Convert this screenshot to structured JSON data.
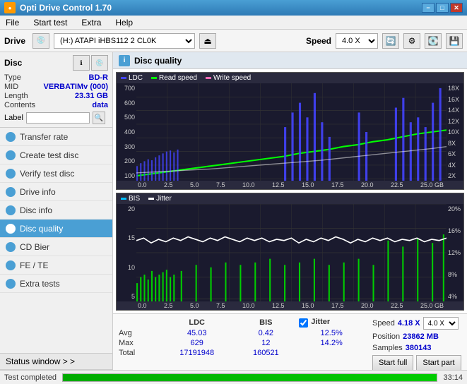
{
  "titlebar": {
    "title": "Opti Drive Control 1.70",
    "minimize": "−",
    "maximize": "□",
    "close": "✕"
  },
  "menubar": {
    "items": [
      "File",
      "Start test",
      "Extra",
      "Help"
    ]
  },
  "toolbar": {
    "drive_label": "Drive",
    "drive_value": "(H:) ATAPI iHBS112  2 CL0K",
    "speed_label": "Speed",
    "speed_value": "4.0 X"
  },
  "sidebar": {
    "disc_header": "Disc",
    "disc_info": [
      {
        "key": "Type",
        "value": "BD-R"
      },
      {
        "key": "MID",
        "value": "VERBATIMv (000)"
      },
      {
        "key": "Length",
        "value": "23.31 GB"
      },
      {
        "key": "Contents",
        "value": "data"
      }
    ],
    "label_placeholder": "",
    "nav_items": [
      {
        "id": "transfer-rate",
        "label": "Transfer rate",
        "active": false
      },
      {
        "id": "create-test-disc",
        "label": "Create test disc",
        "active": false
      },
      {
        "id": "verify-test-disc",
        "label": "Verify test disc",
        "active": false
      },
      {
        "id": "drive-info",
        "label": "Drive info",
        "active": false
      },
      {
        "id": "disc-info",
        "label": "Disc info",
        "active": false
      },
      {
        "id": "disc-quality",
        "label": "Disc quality",
        "active": true
      },
      {
        "id": "cd-bier",
        "label": "CD Bier",
        "active": false
      },
      {
        "id": "fe-te",
        "label": "FE / TE",
        "active": false
      },
      {
        "id": "extra-tests",
        "label": "Extra tests",
        "active": false
      }
    ],
    "status_window": "Status window > >"
  },
  "disc_quality": {
    "title": "Disc quality",
    "icon": "i",
    "legend_top": [
      "LDC",
      "Read speed",
      "Write speed"
    ],
    "legend_bottom": [
      "BIS",
      "Jitter"
    ],
    "chart_top": {
      "y_left": [
        "700",
        "600",
        "500",
        "400",
        "300",
        "200",
        "100"
      ],
      "y_right": [
        "18X",
        "16X",
        "14X",
        "12X",
        "10X",
        "8X",
        "6X",
        "4X",
        "2X"
      ],
      "x_axis": [
        "0.0",
        "2.5",
        "5.0",
        "7.5",
        "10.0",
        "12.5",
        "15.0",
        "17.5",
        "20.0",
        "22.5",
        "25.0 GB"
      ]
    },
    "chart_bottom": {
      "y_left": [
        "20",
        "15",
        "10",
        "5"
      ],
      "y_right": [
        "20%",
        "16%",
        "12%",
        "8%",
        "4%"
      ],
      "x_axis": [
        "0.0",
        "2.5",
        "5.0",
        "7.5",
        "10.0",
        "12.5",
        "15.0",
        "17.5",
        "20.0",
        "22.5",
        "25.0 GB"
      ]
    },
    "stats": {
      "headers": [
        "LDC",
        "BIS",
        "Jitter"
      ],
      "jitter_checked": true,
      "rows": [
        {
          "label": "Avg",
          "ldc": "45.03",
          "bis": "0.42",
          "jitter": "12.5%"
        },
        {
          "label": "Max",
          "ldc": "629",
          "bis": "12",
          "jitter": "14.2%"
        },
        {
          "label": "Total",
          "ldc": "17191948",
          "bis": "160521",
          "jitter": ""
        }
      ],
      "speed_label": "Speed",
      "speed_val": "4.18 X",
      "speed_select": "4.0 X",
      "position_label": "Position",
      "position_val": "23862 MB",
      "samples_label": "Samples",
      "samples_val": "380143",
      "start_full": "Start full",
      "start_part": "Start part"
    }
  },
  "statusbar": {
    "text": "Test completed",
    "progress": 100,
    "time": "33:14"
  }
}
